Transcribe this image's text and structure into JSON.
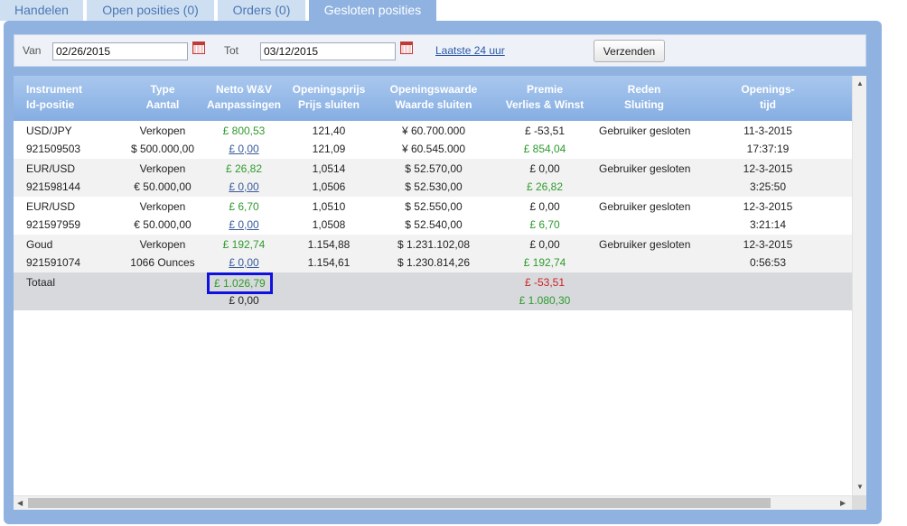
{
  "tabs": [
    "Handelen",
    "Open posities (0)",
    "Orders (0)",
    "Gesloten posities"
  ],
  "active_tab": 3,
  "filter": {
    "from_label": "Van",
    "from_value": "02/26/2015",
    "to_label": "Tot",
    "to_value": "03/12/2015",
    "last24_link": "Laatste 24 uur",
    "submit_label": "Verzenden"
  },
  "columns": [
    [
      "Instrument",
      "Id-positie"
    ],
    [
      "Type",
      "Aantal"
    ],
    [
      "Netto W&V",
      "Aanpassingen"
    ],
    [
      "Openingsprijs",
      "Prijs sluiten"
    ],
    [
      "Openingswaarde",
      "Waarde sluiten"
    ],
    [
      "Premie",
      "Verlies & Winst"
    ],
    [
      "Reden",
      "Sluiting"
    ],
    [
      "Openings-",
      "tijd"
    ]
  ],
  "rows": [
    {
      "instrument": "USD/JPY",
      "id": "921509503",
      "type": "Verkopen",
      "amount": "$ 500.000,00",
      "net_pl": "£ 800,53",
      "adjust": "£ 0,00",
      "open_price": "121,40",
      "close_price": "121,09",
      "open_value": "¥ 60.700.000",
      "close_value": "¥ 60.545.000",
      "premium": "£ -53,51",
      "pl": "£ 854,04",
      "reason": "Gebruiker gesloten",
      "date": "11-3-2015",
      "time": "17:37:19"
    },
    {
      "instrument": "EUR/USD",
      "id": "921598144",
      "type": "Verkopen",
      "amount": "€ 50.000,00",
      "net_pl": "£ 26,82",
      "adjust": "£ 0,00",
      "open_price": "1,0514",
      "close_price": "1,0506",
      "open_value": "$ 52.570,00",
      "close_value": "$ 52.530,00",
      "premium": "£ 0,00",
      "pl": "£ 26,82",
      "reason": "Gebruiker gesloten",
      "date": "12-3-2015",
      "time": "3:25:50"
    },
    {
      "instrument": "EUR/USD",
      "id": "921597959",
      "type": "Verkopen",
      "amount": "€ 50.000,00",
      "net_pl": "£ 6,70",
      "adjust": "£ 0,00",
      "open_price": "1,0510",
      "close_price": "1,0508",
      "open_value": "$ 52.550,00",
      "close_value": "$ 52.540,00",
      "premium": "£ 0,00",
      "pl": "£ 6,70",
      "reason": "Gebruiker gesloten",
      "date": "12-3-2015",
      "time": "3:21:14"
    },
    {
      "instrument": "Goud",
      "id": "921591074",
      "type": "Verkopen",
      "amount": "1066 Ounces",
      "net_pl": "£ 192,74",
      "adjust": "£ 0,00",
      "open_price": "1.154,88",
      "close_price": "1.154,61",
      "open_value": "$ 1.231.102,08",
      "close_value": "$ 1.230.814,26",
      "premium": "£ 0,00",
      "pl": "£ 192,74",
      "reason": "Gebruiker gesloten",
      "date": "12-3-2015",
      "time": "0:56:53"
    }
  ],
  "total": {
    "label": "Totaal",
    "net_pl": "£ 1.026,79",
    "adjust": "£ 0,00",
    "premium": "£ -53,51",
    "pl": "£ 1.080,30"
  },
  "colors": {
    "tab_bg": "#cfdff2",
    "tab_active_bg": "#8fb2e0",
    "header_bg": "#86aee2",
    "positive": "#2e9b2e",
    "negative": "#cc2222",
    "highlight_box": "#1111dd"
  },
  "scroll_icons": [
    "scroll-up-arrow-icon",
    "scroll-down-arrow-icon",
    "scroll-left-arrow-icon",
    "scroll-right-arrow-icon"
  ]
}
